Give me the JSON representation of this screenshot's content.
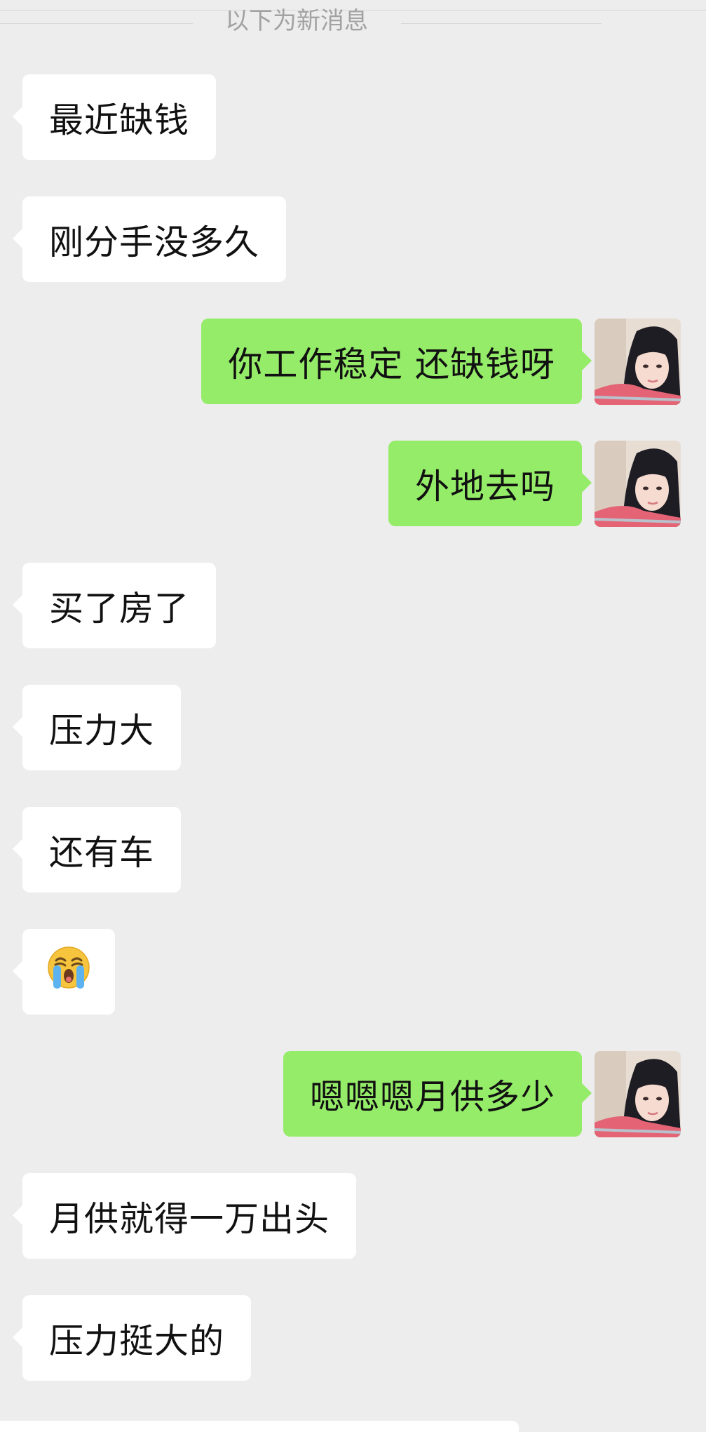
{
  "divider": {
    "label": "以下为新消息"
  },
  "messages": [
    {
      "side": "incoming",
      "text": "最近缺钱"
    },
    {
      "side": "incoming",
      "text": "刚分手没多久"
    },
    {
      "side": "outgoing",
      "text": "你工作稳定 还缺钱呀"
    },
    {
      "side": "outgoing",
      "text": "外地去吗"
    },
    {
      "side": "incoming",
      "text": "买了房了"
    },
    {
      "side": "incoming",
      "text": "压力大"
    },
    {
      "side": "incoming",
      "text": "还有车"
    },
    {
      "side": "incoming",
      "text": "",
      "icon": "loudly-crying-face-emoji"
    },
    {
      "side": "outgoing",
      "text": "嗯嗯嗯月供多少"
    },
    {
      "side": "incoming",
      "text": "月供就得一万出头"
    },
    {
      "side": "incoming",
      "text": "压力挺大的"
    }
  ],
  "colors": {
    "background": "#ededed",
    "incoming_bubble": "#ffffff",
    "outgoing_bubble": "#95ec69",
    "divider_text": "#a2a2a2"
  },
  "avatar": {
    "icon": "user-avatar-photo"
  }
}
